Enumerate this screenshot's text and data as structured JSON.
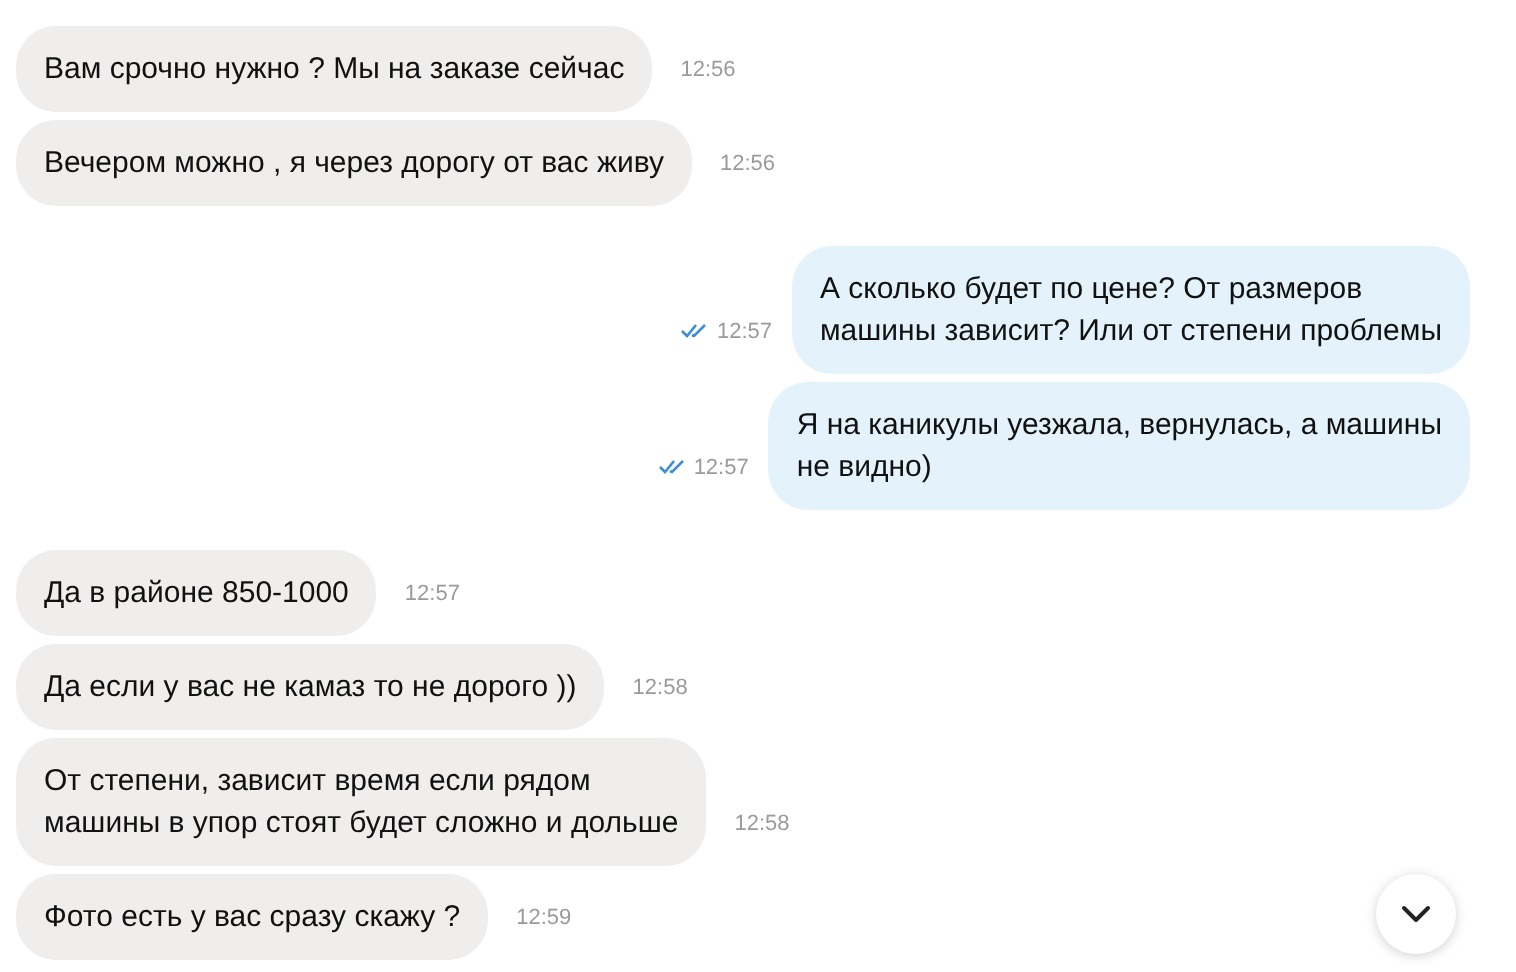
{
  "messages": [
    {
      "kind": "incoming",
      "text": "Вам срочно нужно ? Мы на заказе сейчас",
      "time": "12:56"
    },
    {
      "kind": "incoming",
      "text": "Вечером можно , я через дорогу от вас живу",
      "time": "12:56"
    },
    {
      "kind": "outgoing",
      "text": "А сколько будет по цене? От размеров\nмашины зависит? Или от степени проблемы",
      "time": "12:57",
      "read": true
    },
    {
      "kind": "outgoing",
      "text": "Я на каникулы уезжала, вернулась, а машины\nне видно)",
      "time": "12:57",
      "read": true
    },
    {
      "kind": "incoming",
      "text": "Да в районе 850-1000",
      "time": "12:57"
    },
    {
      "kind": "incoming",
      "text": "Да если у вас не камаз то не дорого ))",
      "time": "12:58"
    },
    {
      "kind": "incoming",
      "text": "От степени, зависит время если рядом\nмашины в упор стоят будет сложно и дольше",
      "time": "12:58"
    },
    {
      "kind": "incoming",
      "text": "Фото есть у вас сразу скажу ?",
      "time": "12:59"
    }
  ]
}
